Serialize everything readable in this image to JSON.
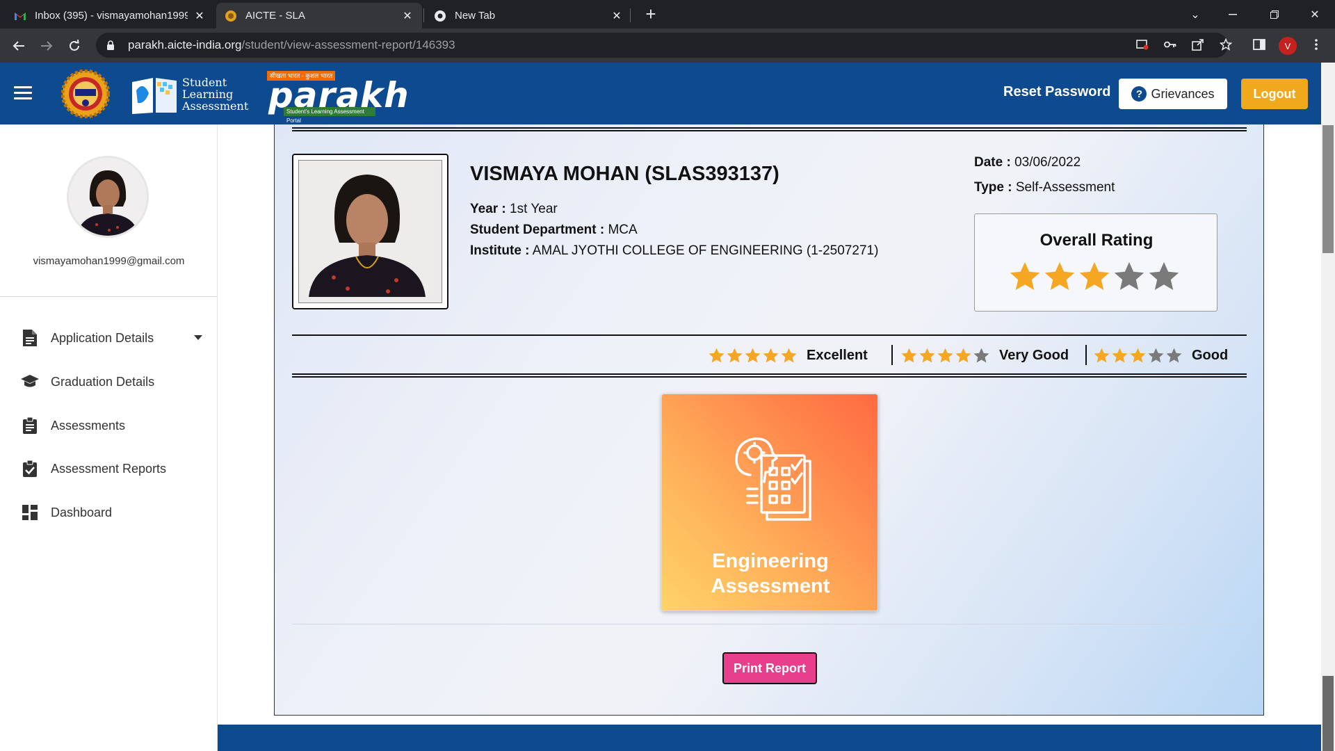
{
  "browser": {
    "tabs": [
      {
        "title": "Inbox (395) - vismayamohan1999",
        "icon": "gmail-icon"
      },
      {
        "title": "AICTE - SLA",
        "icon": "aicte-favicon-icon",
        "active": true
      },
      {
        "title": "New Tab",
        "icon": "chrome-icon"
      }
    ],
    "url_host": "parakh.aicte-india.org",
    "url_path": "/student/view-assessment-report/146393",
    "profile_initial": "V"
  },
  "header": {
    "sla_logo_lines": [
      "Student",
      "Learning",
      "Assessment"
    ],
    "parakh_tagline": "सीखता भारत - कुशल भारत",
    "parakh_word": "parakh",
    "parakh_subtitle": "Student's Learning Assessment Portal",
    "reset_password": "Reset Password",
    "grievances": "Grievances",
    "logout": "Logout",
    "brand_color": "#0e4a8f",
    "logout_color": "#f0a81c"
  },
  "sidebar": {
    "email": "vismayamohan1999@gmail.com",
    "items": [
      {
        "label": "Application Details",
        "icon": "document-icon",
        "has_dropdown": true
      },
      {
        "label": "Graduation Details",
        "icon": "graduation-cap-icon"
      },
      {
        "label": "Assessments",
        "icon": "clipboard-icon"
      },
      {
        "label": "Assessment Reports",
        "icon": "clipboard-check-icon"
      },
      {
        "label": "Dashboard",
        "icon": "dashboard-icon"
      }
    ]
  },
  "report": {
    "student_name": "VISMAYA MOHAN (SLAS393137)",
    "year_label": "Year :",
    "year_value": "1st Year",
    "department_label": "Student Department :",
    "department_value": "MCA",
    "institute_label": "Institute :",
    "institute_value": "AMAL JYOTHI COLLEGE OF ENGINEERING (1-2507271)",
    "date_label": "Date :",
    "date_value": "03/06/2022",
    "type_label": "Type :",
    "type_value": "Self-Assessment",
    "overall_rating_title": "Overall Rating",
    "overall_rating_stars": 3,
    "rating_max": 5,
    "legend": [
      {
        "stars": 5,
        "label": "Excellent"
      },
      {
        "stars": 4,
        "label": "Very Good"
      },
      {
        "stars": 3,
        "label": "Good"
      }
    ],
    "assessment_card_label": "Engineering\nAssessment",
    "print_button": "Print Report",
    "star_filled_color": "#f5a623",
    "star_empty_color": "#7a7a7a",
    "print_color": "#e83e8c"
  }
}
